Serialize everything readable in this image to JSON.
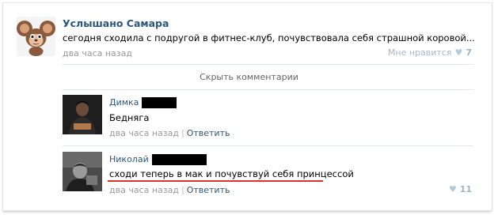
{
  "post": {
    "group_name": "Услышано Самара",
    "text": "сегодня сходила с подругой в фитнес-клуб, почувствовала себя страшной коровой...",
    "time": "два часа назад",
    "likes_label": "Мне нравится",
    "likes_count": "7"
  },
  "hide_comments_label": "Скрыть комментарии",
  "comments": [
    {
      "author": "Димка",
      "text": "Бедняга",
      "time": "два часа назад",
      "reply_label": "Ответить"
    },
    {
      "author": "Николай",
      "text": "сходи теперь в мак и почувствуй себя принцессой",
      "time": "два часа назад",
      "reply_label": "Ответить",
      "likes_count": "11"
    }
  ],
  "colors": {
    "link": "#2b587a",
    "highlight_underline": "#e03030"
  }
}
